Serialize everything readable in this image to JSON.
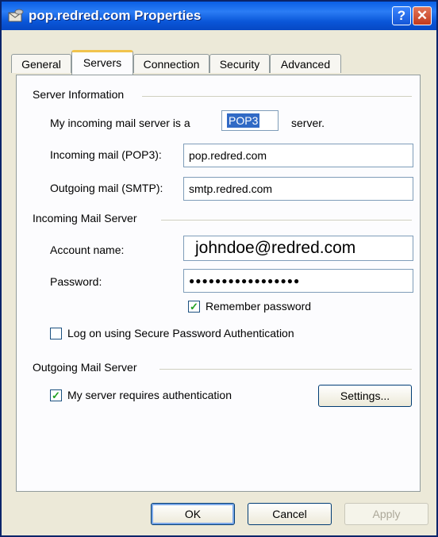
{
  "window": {
    "title": "pop.redred.com Properties",
    "help_glyph": "?",
    "close_glyph": "✕"
  },
  "tabs": [
    {
      "label": "General"
    },
    {
      "label": "Servers",
      "active": true
    },
    {
      "label": "Connection"
    },
    {
      "label": "Security"
    },
    {
      "label": "Advanced"
    }
  ],
  "server_info": {
    "group_label": "Server Information",
    "incoming_type_prefix": "My incoming mail server is a",
    "incoming_type_value": "POP3",
    "incoming_type_suffix": "server.",
    "incoming_label": "Incoming mail (POP3):",
    "incoming_value": "pop.redred.com",
    "outgoing_label": "Outgoing mail (SMTP):",
    "outgoing_value": "smtp.redred.com"
  },
  "incoming_server": {
    "group_label": "Incoming Mail Server",
    "account_label": "Account name:",
    "account_value": "johndoe@redred.com",
    "password_label": "Password:",
    "password_value": "●●●●●●●●●●●●●●●●●",
    "remember_label": "Remember password",
    "remember_checked": true,
    "spa_label": "Log on using Secure Password Authentication",
    "spa_checked": false
  },
  "outgoing_server": {
    "group_label": "Outgoing Mail Server",
    "auth_label": "My server requires authentication",
    "auth_checked": true,
    "settings_label": "Settings..."
  },
  "footer": {
    "ok_label": "OK",
    "cancel_label": "Cancel",
    "apply_label": "Apply"
  },
  "colors": {
    "accent": "#0a56d8",
    "check": "#21a121",
    "tab_highlight": "#f1c34d"
  }
}
